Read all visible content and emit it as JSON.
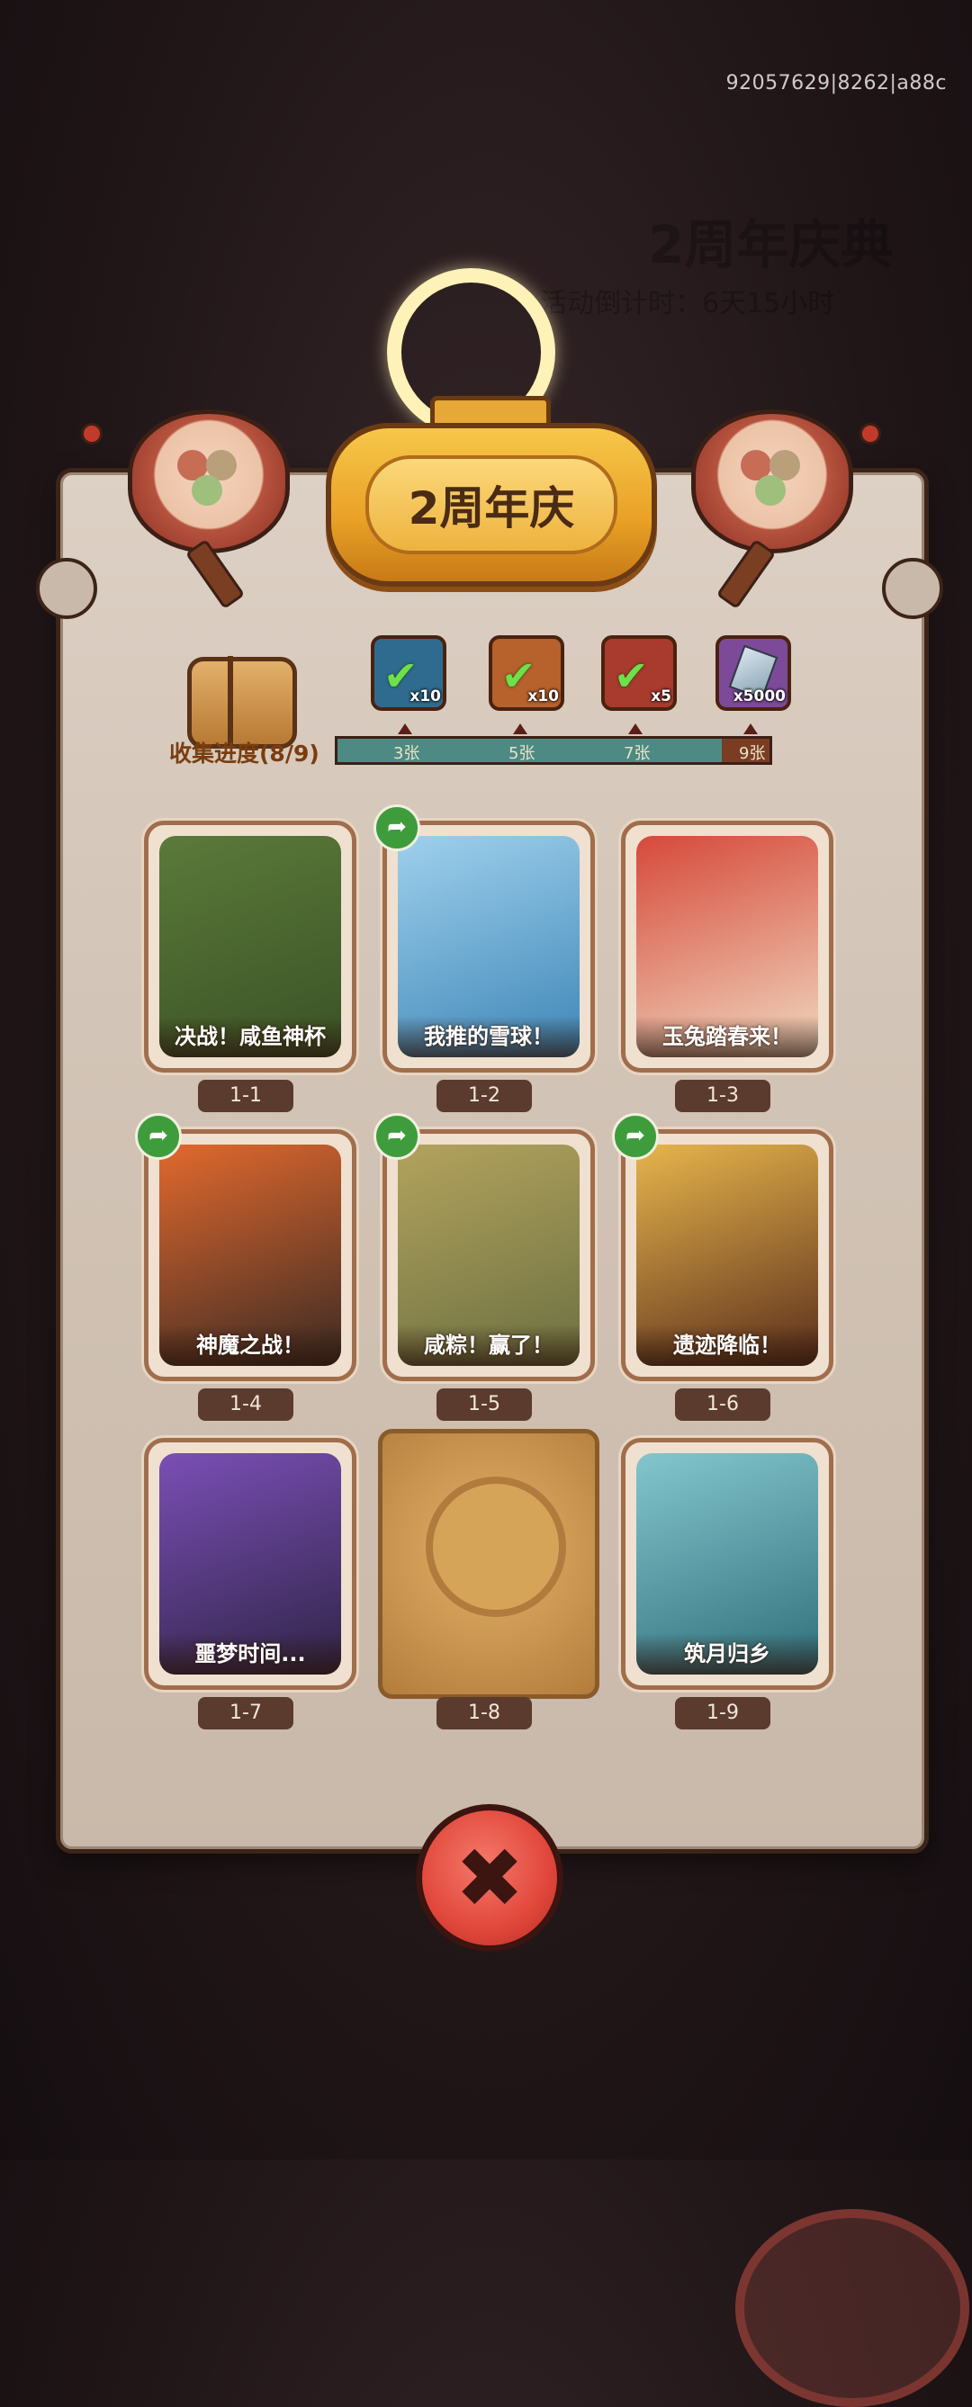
{
  "session": {
    "id_text": "92057629|8262|a88c"
  },
  "background": {
    "hint_title": "2周年庆典",
    "hint_sub": "活动倒计时：6天15小时"
  },
  "panel": {
    "title": "2周年庆"
  },
  "progress": {
    "label": "收集进度(8/9)",
    "collected": 8,
    "total": 9,
    "rewards": [
      {
        "icon": "chest-icon",
        "amount": "x10",
        "claimed": true,
        "color": "#2f6b8e"
      },
      {
        "icon": "key-icon",
        "amount": "x10",
        "claimed": true,
        "color": "#b7612d"
      },
      {
        "icon": "orb-icon",
        "amount": "x5",
        "claimed": true,
        "color": "#a93a2e"
      },
      {
        "icon": "crystal-icon",
        "amount": "x5000",
        "claimed": false,
        "color": "#7d4a99"
      }
    ],
    "milestones": [
      "3张",
      "5张",
      "7张",
      "9张"
    ]
  },
  "cards": [
    {
      "num": "1-1",
      "title": "决战！咸鱼神杯",
      "share": false,
      "bg1": "#5b7a3a",
      "bg2": "#3b5226"
    },
    {
      "num": "1-2",
      "title": "我推的雪球！",
      "share": true,
      "bg1": "#9fd0ec",
      "bg2": "#3e86b7"
    },
    {
      "num": "1-3",
      "title": "玉兔踏春来！",
      "share": false,
      "bg1": "#d6493a",
      "bg2": "#f0d8c0"
    },
    {
      "num": "1-4",
      "title": "神魔之战！",
      "share": true,
      "bg1": "#e2692e",
      "bg2": "#3a2a24"
    },
    {
      "num": "1-5",
      "title": "咸粽！赢了！",
      "share": true,
      "bg1": "#b3a35d",
      "bg2": "#6b7042"
    },
    {
      "num": "1-6",
      "title": "遗迹降临！",
      "share": true,
      "bg1": "#e7b54c",
      "bg2": "#5a2e1c"
    },
    {
      "num": "1-7",
      "title": "噩梦时间...",
      "share": false,
      "bg1": "#7a4fb5",
      "bg2": "#2f2446"
    },
    {
      "num": "1-8",
      "title": "",
      "share": false,
      "locked": true
    },
    {
      "num": "1-9",
      "title": "筑月归乡",
      "share": false,
      "bg1": "#84c6ce",
      "bg2": "#2f6f7a"
    }
  ],
  "close": {
    "label": "✖"
  }
}
